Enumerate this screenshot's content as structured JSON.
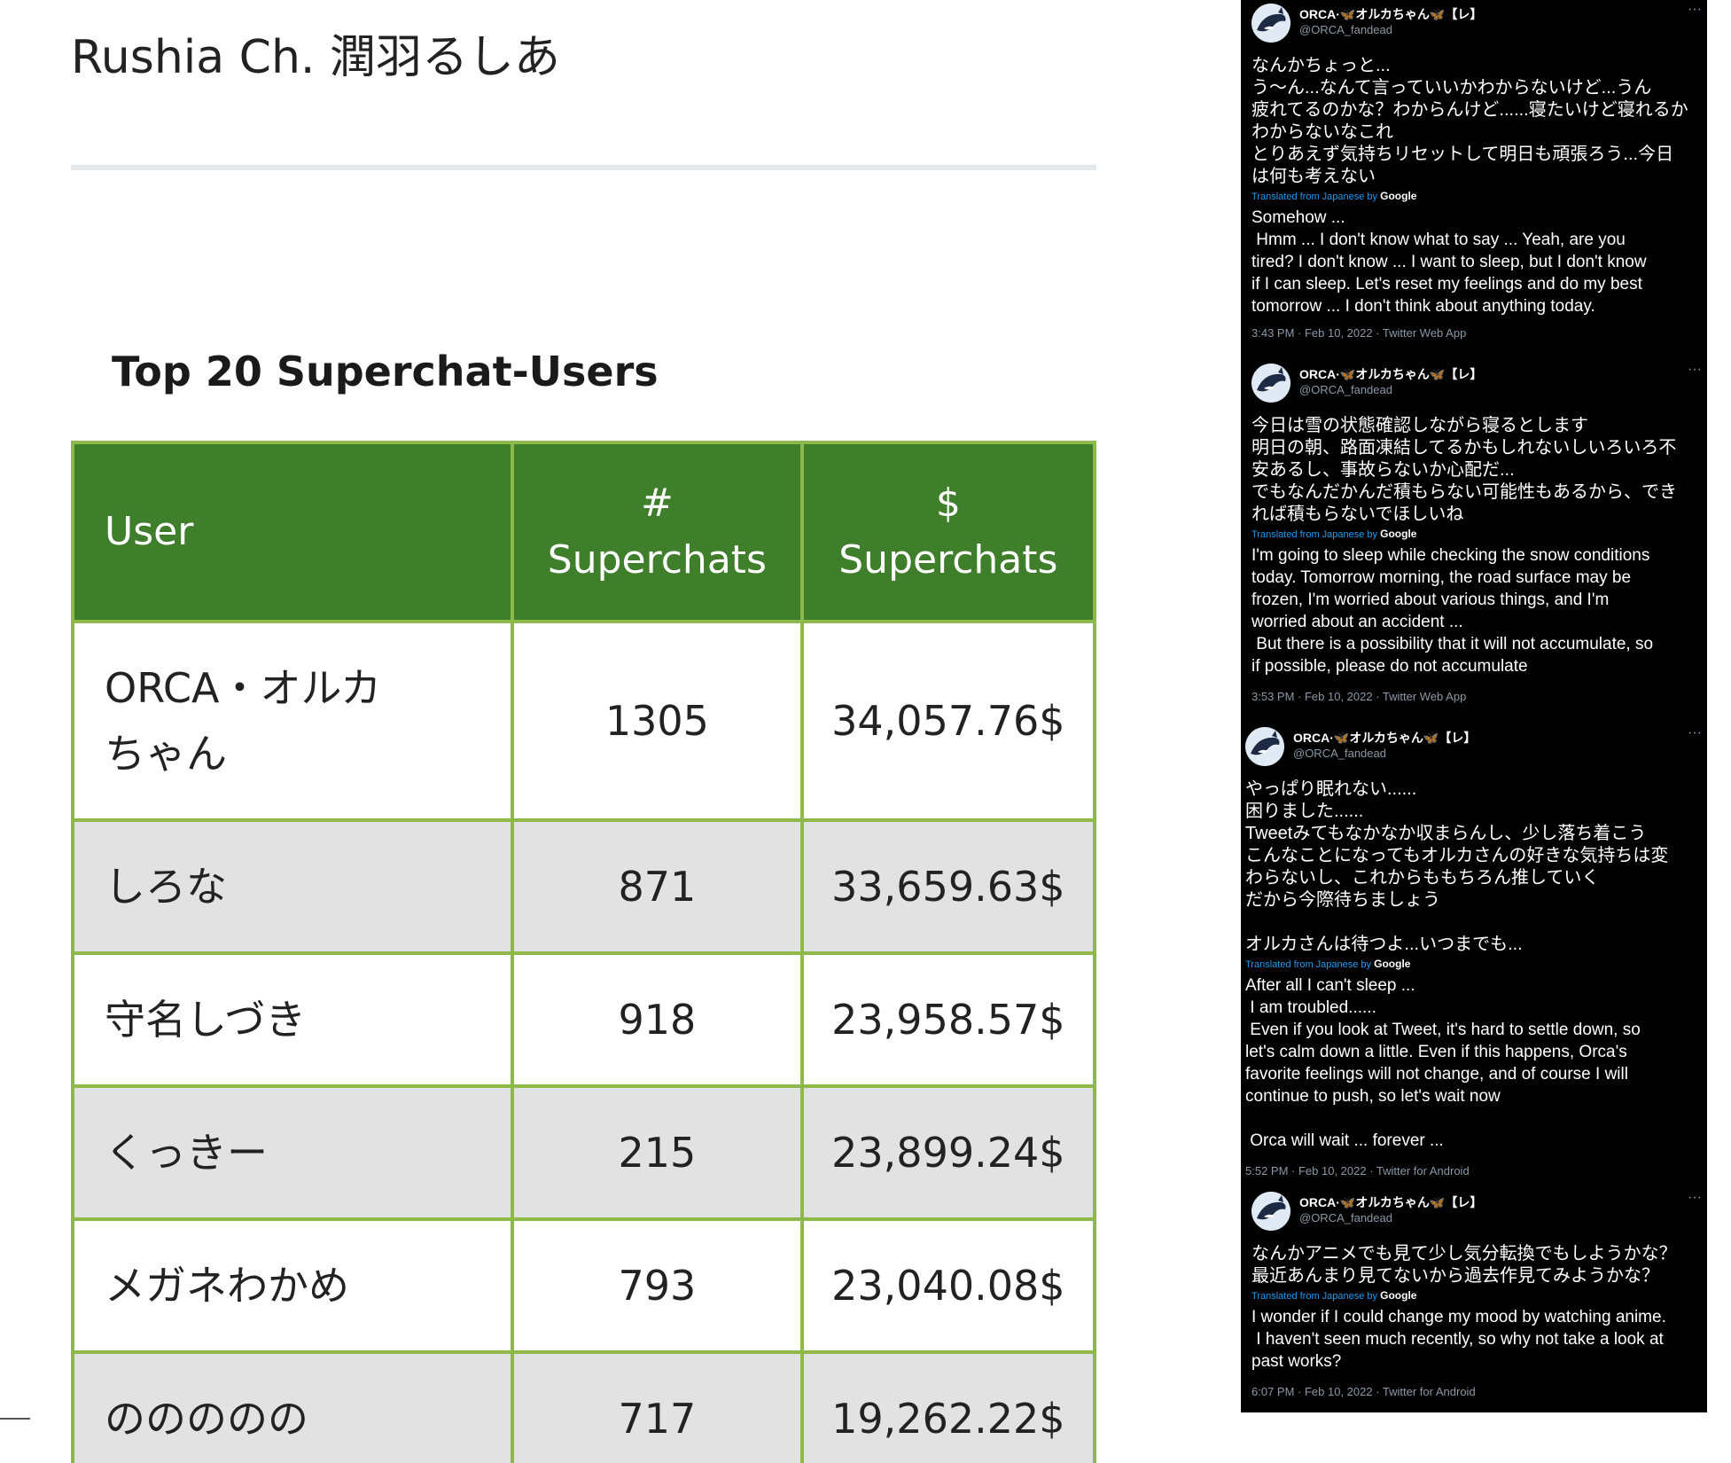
{
  "page": {
    "title": "Rushia Ch. 潤羽るしあ",
    "section_heading": "Top 20 Superchat-Users"
  },
  "table": {
    "headers": [
      "User",
      "#\nSuperchats",
      "$\nSuperchats"
    ],
    "rows": [
      {
        "user": "ORCA・オルカちゃん",
        "count": "1305",
        "amount": "34,057.76$"
      },
      {
        "user": "しろな",
        "count": "871",
        "amount": "33,659.63$"
      },
      {
        "user": "守名しづき",
        "count": "918",
        "amount": "23,958.57$"
      },
      {
        "user": "くっきー",
        "count": "215",
        "amount": "23,899.24$"
      },
      {
        "user": "メガネわかめ",
        "count": "793",
        "amount": "23,040.08$"
      },
      {
        "user": "ののののの",
        "count": "717",
        "amount": "19,262.22$"
      }
    ]
  },
  "tweets": [
    {
      "name": "ORCA·🦋オルカちゃん🦋【レ】",
      "handle": "@ORCA_fandead",
      "more": "···",
      "text_ja": "なんかちょっと...\nう〜ん...なんて言っていいかわからないけど...うん\n疲れてるのかな？わからんけど......寝たいけど寝れるか\nわからないなこれ\nとりあえず気持ちリセットして明日も頑張ろう...今日\nは何も考えない",
      "translated_label": "Translated from Japanese by",
      "translator": "Google",
      "text_en": "Somehow ...\n Hmm ... I don't know what to say ... Yeah, are you\ntired? I don't know ... I want to sleep, but I don't know\nif I can sleep. Let's reset my feelings and do my best\ntomorrow ... I don't think about anything today.",
      "meta": "3:43 PM · Feb 10, 2022 · Twitter Web App"
    },
    {
      "name": "ORCA·🦋オルカちゃん🦋【レ】",
      "handle": "@ORCA_fandead",
      "more": "···",
      "text_ja": "今日は雪の状態確認しながら寝るとします\n明日の朝、路面凍結してるかもしれないしいろいろ不\n安あるし、事故らないか心配だ...\nでもなんだかんだ積もらない可能性もあるから、でき\nれば積もらないでほしいね",
      "translated_label": "Translated from Japanese by",
      "translator": "Google",
      "text_en": "I'm going to sleep while checking the snow conditions\ntoday. Tomorrow morning, the road surface may be\nfrozen, I'm worried about various things, and I'm\nworried about an accident ...\n But there is a possibility that it will not accumulate, so\nif possible, please do not accumulate",
      "meta": "3:53 PM · Feb 10, 2022 · Twitter Web App"
    },
    {
      "name": "ORCA·🦋オルカちゃん🦋【レ】",
      "handle": "@ORCA_fandead",
      "more": "···",
      "text_ja": "やっぱり眠れない......\n困りました......\nTweetみてもなかなか収まらんし、少し落ち着こう\nこんなことになってもオルカさんの好きな気持ちは変\nわらないし、これからももちろん推していく\nだから今際待ちましょう\n\nオルカさんは待つよ...いつまでも...",
      "translated_label": "Translated from Japanese by",
      "translator": "Google",
      "text_en": "After all I can't sleep ...\n I am troubled......\n Even if you look at Tweet, it's hard to settle down, so\nlet's calm down a little. Even if this happens, Orca's\nfavorite feelings will not change, and of course I will\ncontinue to push, so let's wait now\n\n Orca will wait ... forever ...",
      "meta": "5:52 PM · Feb 10, 2022 · Twitter for Android"
    },
    {
      "name": "ORCA·🦋オルカちゃん🦋【レ】",
      "handle": "@ORCA_fandead",
      "more": "···",
      "text_ja": "なんかアニメでも見て少し気分転換でもしようかな？\n最近あんまり見てないから過去作見てみようかな？",
      "translated_label": "Translated from Japanese by",
      "translator": "Google",
      "text_en": "I wonder if I could change my mood by watching anime.\n I haven't seen much recently, so why not take a look at\npast works?",
      "meta": "6:07 PM · Feb 10, 2022 · Twitter for Android"
    }
  ],
  "colors": {
    "header_green": "#3f7e2a",
    "border_green": "#8db84a",
    "row_alt_gray": "#e2e2e2",
    "translate_blue": "#1d9bf0",
    "tweet_meta_gray": "#8b98a5"
  },
  "icons": {
    "avatar": "orca-avatar-icon",
    "more": "more-options-icon"
  }
}
